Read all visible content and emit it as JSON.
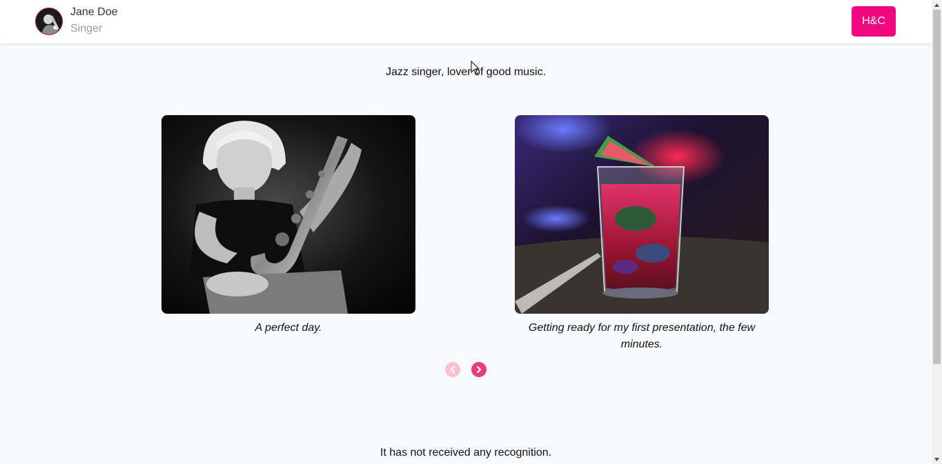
{
  "header": {
    "user_name": "Jane Doe",
    "user_role": "Singer",
    "brand_button_label": "H&C"
  },
  "profile": {
    "bio": "Jazz singer, lover of good music."
  },
  "gallery": {
    "items": [
      {
        "caption": "A perfect day.",
        "image": "black-and-white photo of woman playing saxophone"
      },
      {
        "caption": "Getting ready for my first presentation, the few minutes.",
        "image": "cocktail glass with watermelon slice under neon lights"
      }
    ],
    "prev_disabled": true,
    "next_disabled": false
  },
  "recognition": {
    "text": "It has not received any recognition."
  },
  "colors": {
    "accent": "#f0077f",
    "nav_active": "#e63e7b",
    "nav_disabled": "#f7c0d3",
    "background": "#f8f9fb"
  }
}
